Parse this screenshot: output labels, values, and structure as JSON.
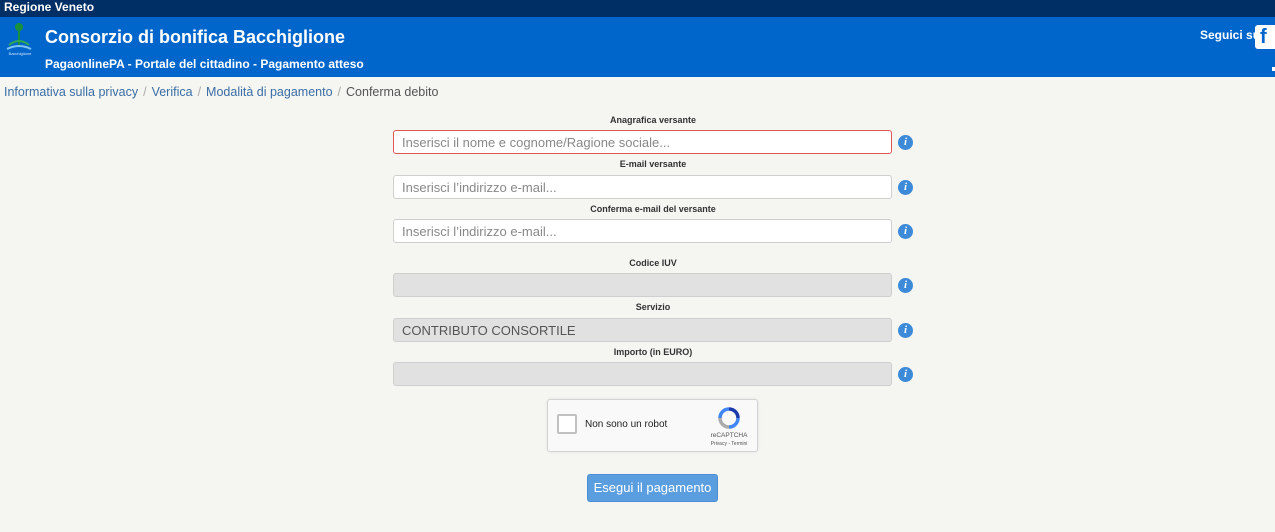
{
  "topbar": {
    "region": "Regione Veneto"
  },
  "header": {
    "logo_text": "Bacchiglione",
    "title": "Consorzio di bonifica Bacchiglione",
    "subtitle": "PagaonlinePA - Portale del cittadino - Pagamento atteso",
    "follow_label": "Seguici su",
    "facebook_glyph": "f"
  },
  "breadcrumb": {
    "items": [
      "Informativa sulla privacy",
      "Verifica",
      "Modalità di pagamento"
    ],
    "separator": "/",
    "current": "Conferma debito"
  },
  "form": {
    "name": {
      "label": "Anagrafica versante",
      "placeholder": "Inserisci il nome e cognome/Ragione sociale...",
      "value": ""
    },
    "email": {
      "label": "E-mail versante",
      "placeholder": "Inserisci l’indirizzo e-mail...",
      "value": ""
    },
    "email_confirm": {
      "label": "Conferma e-mail del versante",
      "placeholder": "Inserisci l’indirizzo e-mail...",
      "value": ""
    },
    "iuv": {
      "label": "Codice IUV",
      "value": ""
    },
    "service": {
      "label": "Servizio",
      "value": "CONTRIBUTO CONSORTILE"
    },
    "amount": {
      "label": "Importo (in EURO)",
      "value": ""
    },
    "info_glyph": "i"
  },
  "captcha": {
    "label": "Non sono un robot",
    "brand": "reCAPTCHA",
    "terms": "Privacy - Termini"
  },
  "submit": {
    "label": "Esegui il pagamento"
  },
  "colors": {
    "topbar": "#002f66",
    "header": "#0066cc",
    "button": "#5a9ee0",
    "info": "#3c8ad8",
    "error": "#e05555"
  }
}
